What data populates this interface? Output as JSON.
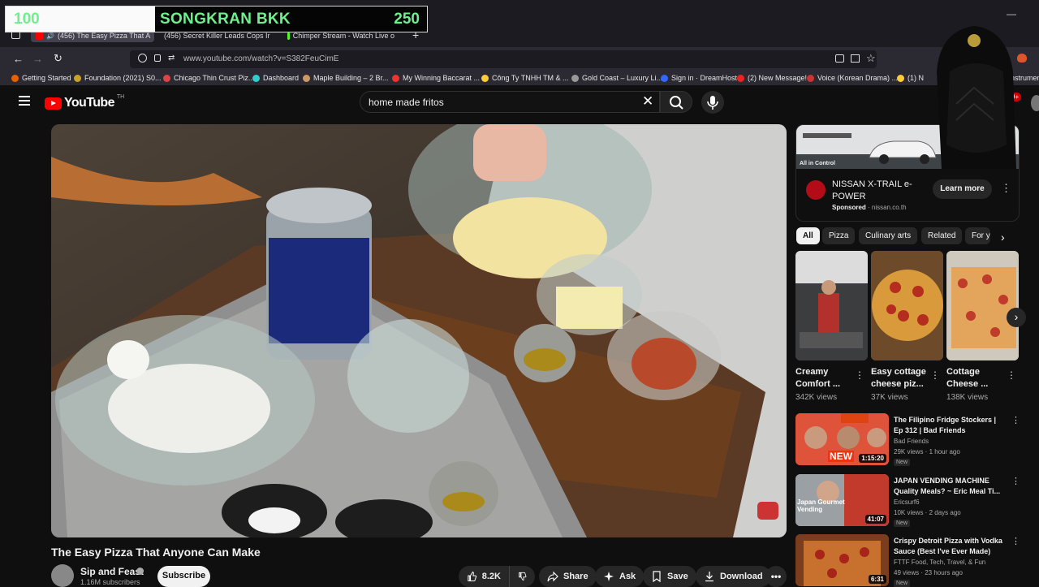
{
  "overlay": {
    "left_score": "100",
    "title": "SONGKRAN BKK",
    "right_score": "250"
  },
  "tabs": [
    {
      "label": "(456) The Easy Pizza That A"
    },
    {
      "label": "(456) Secret Killer Leads Cops Ir"
    },
    {
      "label": "Chimper Stream - Watch Live o"
    }
  ],
  "browser": {
    "url": "www.youtube.com/watch?v=S382FeuCimE",
    "new_tab": "+",
    "profile_text": "in"
  },
  "bookmarks": [
    {
      "label": "Getting Started",
      "color": "#e66000"
    },
    {
      "label": "Foundation (2021) S0...",
      "color": "#c9a227"
    },
    {
      "label": "Chicago Thin Crust Piz...",
      "color": "#d44"
    },
    {
      "label": "Dashboard",
      "color": "#3cc"
    },
    {
      "label": "Maple Building – 2 Br...",
      "color": "#c96"
    },
    {
      "label": "My Winning Baccarat ...",
      "color": "#e33"
    },
    {
      "label": "Công Ty TNHH TM & ...",
      "color": "#fc3"
    },
    {
      "label": "Gold Coast – Luxury Li...",
      "color": "#999"
    },
    {
      "label": "Sign in · DreamHost",
      "color": "#36f"
    },
    {
      "label": "(2) New Message!",
      "color": "#e22"
    },
    {
      "label": "Voice (Korean Drama) ...",
      "color": "#c33"
    },
    {
      "label": "(1) N",
      "color": "#fc3"
    },
    {
      "label": "nstruments T",
      "color": "#999"
    }
  ],
  "youtube": {
    "logo": "YouTube",
    "logo_sup": "TH",
    "search_value": "home made fritos",
    "notifications": "9+"
  },
  "video": {
    "title": "The Easy Pizza That Anyone Can Make",
    "channel": "Sip and Feast",
    "subscribers": "1.16M subscribers",
    "subscribe_label": "Subscribe",
    "likes": "8.2K",
    "share_label": "Share",
    "ask_label": "Ask",
    "save_label": "Save",
    "download_label": "Download"
  },
  "ad": {
    "title": "NISSAN X-TRAIL e-POWER",
    "sponsored": "Sponsored",
    "domain": "nissan.co.th",
    "cta": "Learn more",
    "image_caption": "All in Control"
  },
  "chips": [
    "All",
    "Pizza",
    "Culinary arts",
    "Related",
    "For y"
  ],
  "shorts": [
    {
      "title": "Creamy Comfort ...",
      "views": "342K views"
    },
    {
      "title": "Easy cottage cheese piz...",
      "views": "37K views"
    },
    {
      "title": "Cottage Cheese ...",
      "views": "138K views"
    }
  ],
  "recommendations": [
    {
      "title": "The Filipino Fridge Stockers | Ep 312 | Bad Friends",
      "channel": "Bad Friends",
      "meta": "29K views · 1 hour ago",
      "badge": "New",
      "duration": "1:15:20",
      "thumb_text": "NEW"
    },
    {
      "title": "JAPAN VENDING MACHINE Quality Meals? ~ Eric Meal Ti...",
      "channel": "Ericsurf6",
      "meta": "10K views · 2 days ago",
      "badge": "New",
      "duration": "41:07",
      "thumb_text": "Japan Gourmet Vending"
    },
    {
      "title": "Crispy Detroit Pizza with Vodka Sauce (Best I've Ever Made)",
      "channel": "FTTF Food, Tech, Travel, & Fun",
      "meta": "49 views · 23 hours ago",
      "badge": "New",
      "duration": "6:31",
      "thumb_text": ""
    }
  ]
}
